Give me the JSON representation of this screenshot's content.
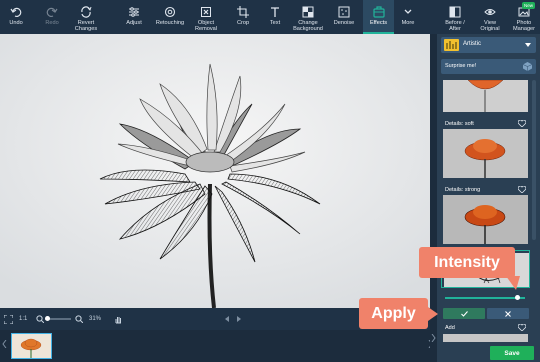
{
  "toolbar": {
    "undo": "Undo",
    "redo": "Redo",
    "revert": "Revert\nChanges",
    "adjust": "Adjust",
    "retouching": "Retouching",
    "object_removal": "Object\nRemoval",
    "crop": "Crop",
    "text": "Text",
    "change_background": "Change\nBackground",
    "denoise": "Denoise",
    "effects": "Effects",
    "more": "More",
    "before_after": "Before /\nAfter",
    "view_original": "View\nOriginal",
    "photo_manager": "Photo\nManager",
    "new_badge": "New"
  },
  "status": {
    "fit": "1:1",
    "zoom": "31%"
  },
  "panel": {
    "category": "Artistic",
    "surprise": "Surprise me!",
    "effects": [
      {
        "name": ""
      },
      {
        "name": "Details: soft"
      },
      {
        "name": "Details: strong"
      },
      {
        "name": "Add"
      }
    ],
    "intensity_value": 0.9,
    "save": "Save"
  },
  "callouts": {
    "intensity": "Intensity",
    "apply": "Apply"
  },
  "colors": {
    "accent": "#21b39a",
    "save": "#1fb05a",
    "callout": "#f0826a",
    "toolbar": "#1f3246"
  }
}
